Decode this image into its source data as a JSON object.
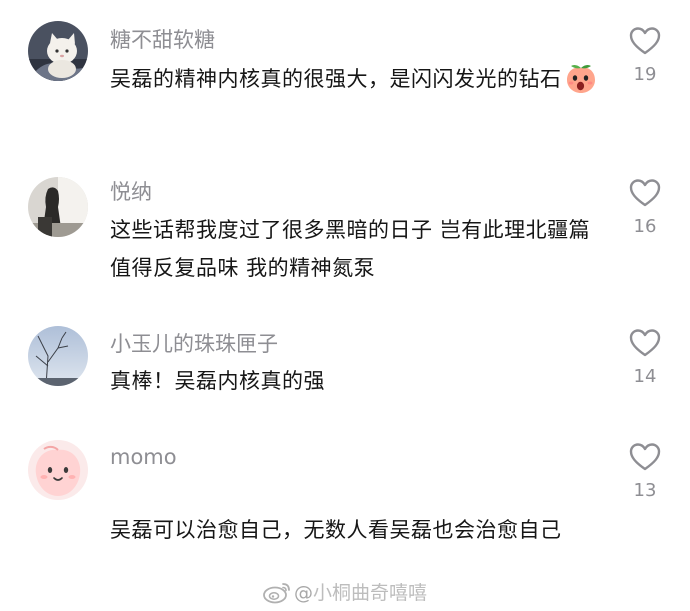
{
  "comments": [
    {
      "username": "糖不甜软糖",
      "text": "吴磊的精神内核真的很强大，是闪闪发光的钻石",
      "likes": "19",
      "emoji": "screaming-peach-emoji",
      "avatar": "cat-doll-avatar"
    },
    {
      "username": "悦纳",
      "text": "这些话帮我度过了很多黑暗的日子 岂有此理北疆篇值得反复品味 我的精神氮泵",
      "likes": "16",
      "avatar": "silhouette-photo-avatar"
    },
    {
      "username": "小玉儿的珠珠匣子",
      "text": "真棒！吴磊内核真的强",
      "likes": "14",
      "avatar": "tree-sky-avatar"
    },
    {
      "username": "momo",
      "text": "吴磊可以治愈自己，无数人看吴磊也会治愈自己",
      "likes": "13",
      "avatar": "pink-peach-avatar"
    }
  ],
  "like_icon": "heart-outline-icon",
  "watermark": {
    "icon": "weibo-logo-icon",
    "prefix": "@",
    "handle": "小桐曲奇嘻嘻"
  },
  "colors": {
    "username": "#8e8e93",
    "text": "#161616",
    "icon": "#8e8e93"
  }
}
